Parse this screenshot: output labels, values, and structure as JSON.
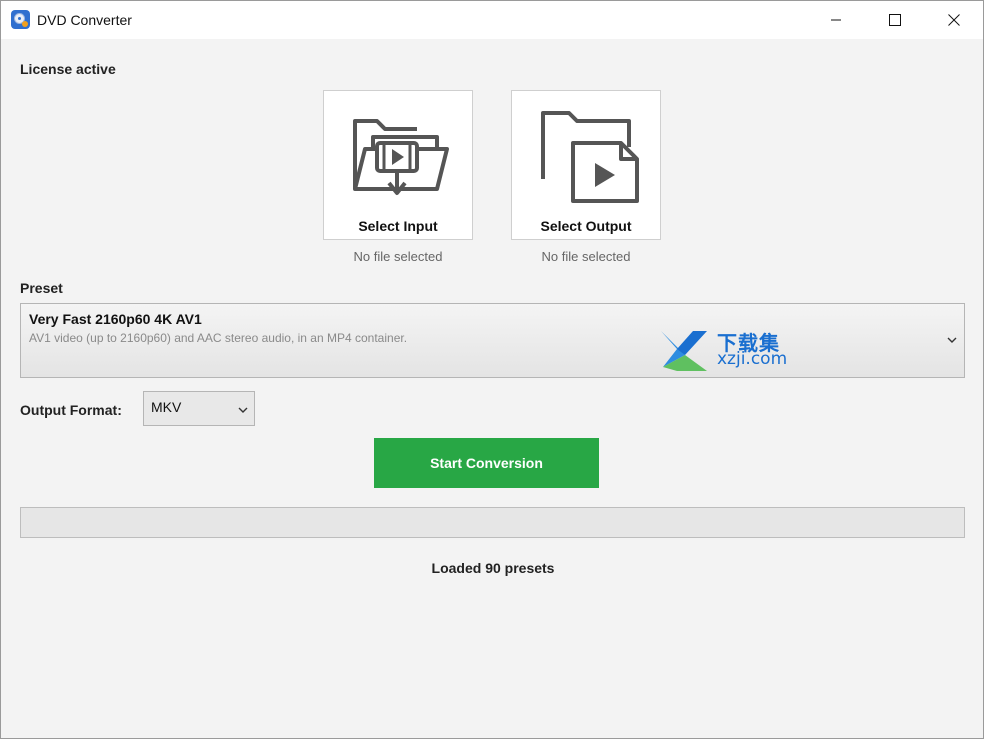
{
  "window": {
    "title": "DVD Converter",
    "icons": {
      "app": "dvd-disc-icon",
      "minimize": "minimize-icon",
      "maximize": "maximize-icon",
      "close": "close-icon"
    }
  },
  "license": {
    "status": "License active"
  },
  "input": {
    "label": "Select Input",
    "status": "No file selected",
    "icon": "folder-video-import-icon"
  },
  "output": {
    "label": "Select Output",
    "status": "No file selected",
    "icon": "folder-video-file-icon"
  },
  "preset": {
    "label": "Preset",
    "selected_name": "Very Fast 2160p60 4K AV1",
    "selected_description": "AV1 video (up to 2160p60) and AAC stereo audio, in an MP4  container."
  },
  "watermark": {
    "cn": "下载集",
    "en": "xzji.com"
  },
  "format": {
    "label": "Output Format:",
    "selected": "MKV"
  },
  "actions": {
    "start_label": "Start Conversion",
    "accent_color": "#28a745"
  },
  "progress": {
    "value": 0
  },
  "status": {
    "message": "Loaded 90 presets"
  }
}
